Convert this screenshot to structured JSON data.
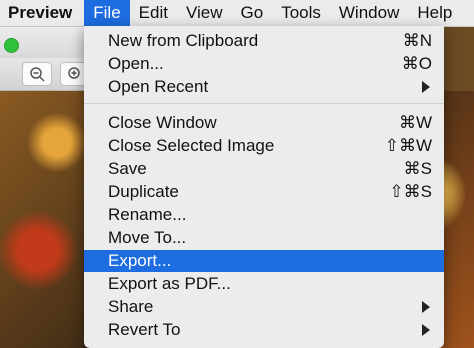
{
  "menubar": {
    "app": "Preview",
    "items": [
      "File",
      "Edit",
      "View",
      "Go",
      "Tools",
      "Window",
      "Help"
    ]
  },
  "menu": {
    "items": [
      {
        "label": "New from Clipboard",
        "shortcut": "⌘N"
      },
      {
        "label": "Open...",
        "shortcut": "⌘O"
      },
      {
        "label": "Open Recent",
        "submenu": true
      },
      {
        "label": "Close Window",
        "shortcut": "⌘W"
      },
      {
        "label": "Close Selected Image",
        "shortcut": "⇧⌘W"
      },
      {
        "label": "Save",
        "shortcut": "⌘S"
      },
      {
        "label": "Duplicate",
        "shortcut": "⇧⌘S"
      },
      {
        "label": "Rename...",
        "shortcut": ""
      },
      {
        "label": "Move To...",
        "shortcut": ""
      },
      {
        "label": "Export...",
        "shortcut": "",
        "highlighted": true
      },
      {
        "label": "Export as PDF...",
        "shortcut": ""
      },
      {
        "label": "Share",
        "submenu": true
      },
      {
        "label": "Revert To",
        "submenu": true
      }
    ]
  },
  "icons": {
    "zoom_out": "zoom-out-icon",
    "zoom_in": "zoom-in-icon"
  },
  "colors": {
    "highlight": "#1d6ce0",
    "menu_bg": "#ececec"
  }
}
